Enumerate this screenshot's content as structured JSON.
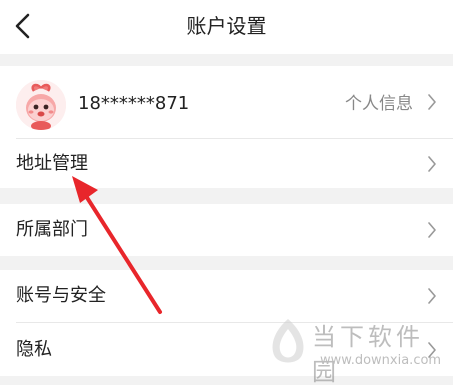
{
  "header": {
    "title": "账户设置",
    "back_icon": "back-chevron-icon"
  },
  "profile": {
    "phone": "18******871",
    "info_label": "个人信息",
    "avatar_icon": "peach-mascot-avatar"
  },
  "menu": {
    "address": "地址管理",
    "department": "所属部门",
    "security": "账号与安全",
    "privacy": "隐私"
  },
  "annotation": {
    "arrow_color": "#e8262b"
  },
  "watermark": {
    "brand": "当下软件园",
    "url": "www.downxia.com"
  }
}
